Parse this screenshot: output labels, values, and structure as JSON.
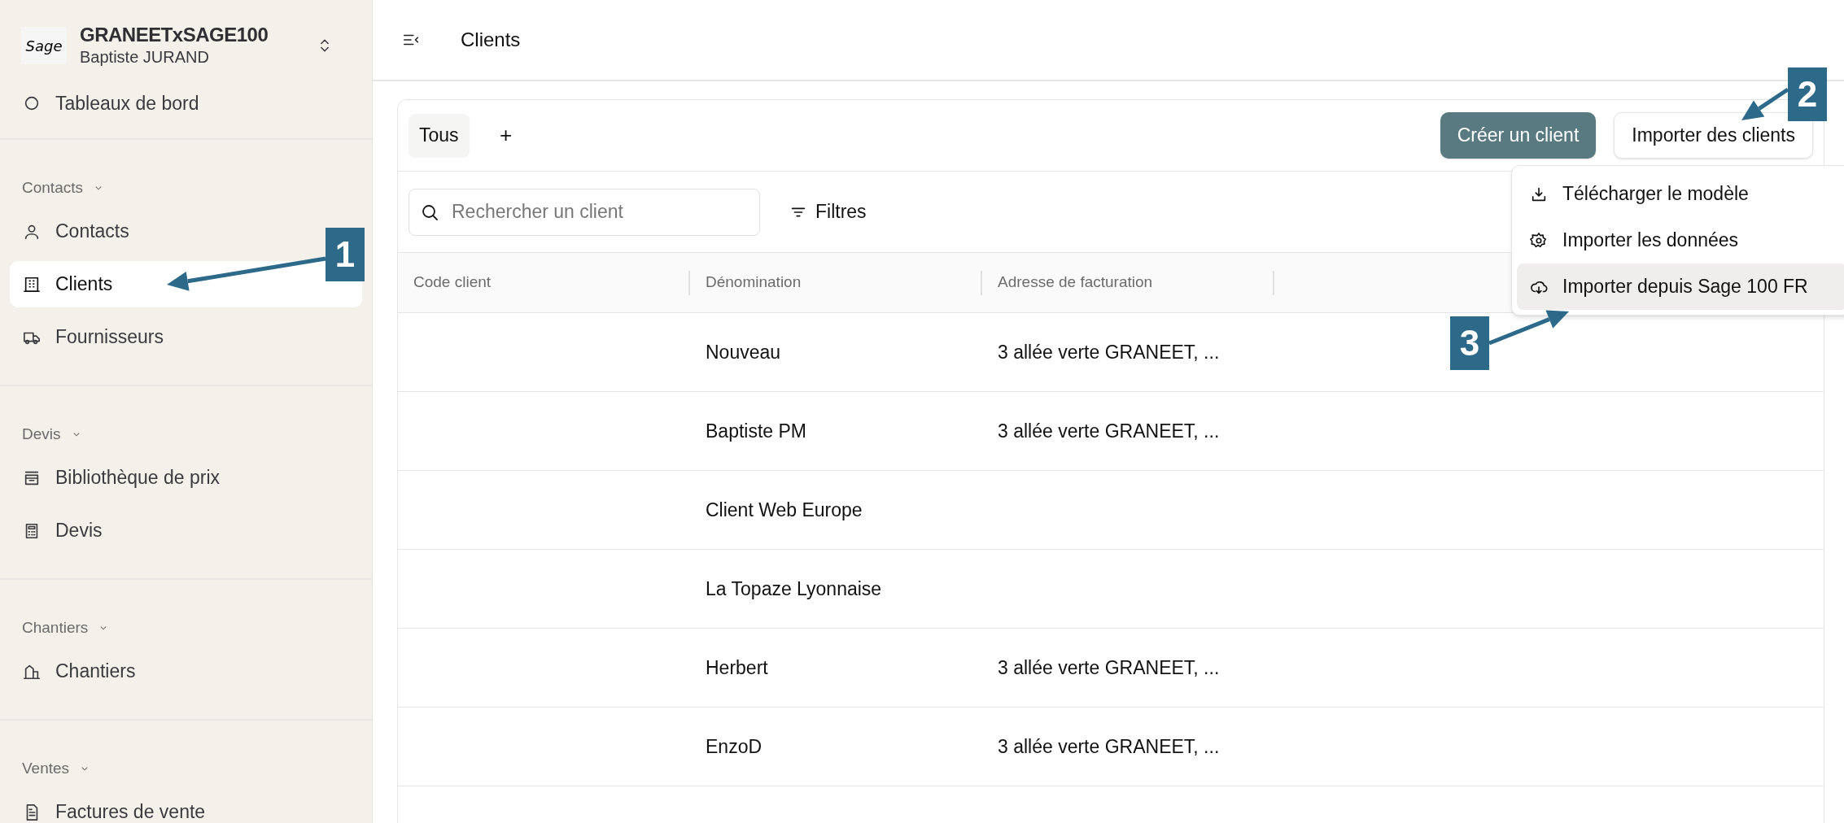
{
  "sidebar": {
    "org": {
      "logo": "Sage",
      "name": "GRANEETxSAGE100",
      "user": "Baptiste JURAND"
    },
    "top_item": {
      "label": "Tableaux de bord"
    },
    "sections": [
      {
        "label": "Contacts",
        "items": [
          {
            "label": "Contacts",
            "selected": false
          },
          {
            "label": "Clients",
            "selected": true
          },
          {
            "label": "Fournisseurs",
            "selected": false
          }
        ]
      },
      {
        "label": "Devis",
        "items": [
          {
            "label": "Bibliothèque de prix",
            "selected": false
          },
          {
            "label": "Devis",
            "selected": false
          }
        ]
      },
      {
        "label": "Chantiers",
        "items": [
          {
            "label": "Chantiers",
            "selected": false
          }
        ]
      },
      {
        "label": "Ventes",
        "items": [
          {
            "label": "Factures de vente",
            "selected": false
          }
        ]
      }
    ]
  },
  "header": {
    "title": "Clients"
  },
  "tabs": [
    {
      "label": "Tous",
      "selected": true
    }
  ],
  "add_tab": "+",
  "buttons": {
    "create": "Créer un client",
    "import": "Importer des clients"
  },
  "search": {
    "placeholder": "Rechercher un client"
  },
  "filters": "Filtres",
  "table": {
    "columns": [
      "Code client",
      "Dénomination",
      "Adresse de facturation"
    ],
    "rows": [
      {
        "name": "Nouveau",
        "address": "3 allée verte GRANEET, ..."
      },
      {
        "name": "Baptiste PM",
        "address": "3 allée verte GRANEET, ..."
      },
      {
        "name": "Client Web Europe"
      },
      {
        "name": "La Topaze Lyonnaise"
      },
      {
        "name": "Herbert",
        "address": "3 allée verte GRANEET, ..."
      },
      {
        "name": "EnzoD",
        "address": "3 allée verte GRANEET, ..."
      }
    ]
  },
  "import_menu": {
    "items": [
      {
        "label": "Télécharger le modèle",
        "selected": false
      },
      {
        "label": "Importer les données",
        "selected": false
      },
      {
        "label": "Importer depuis Sage 100 FR",
        "selected": true
      }
    ]
  },
  "callouts": [
    {
      "label": "1"
    },
    {
      "label": "2"
    },
    {
      "label": "3"
    }
  ]
}
